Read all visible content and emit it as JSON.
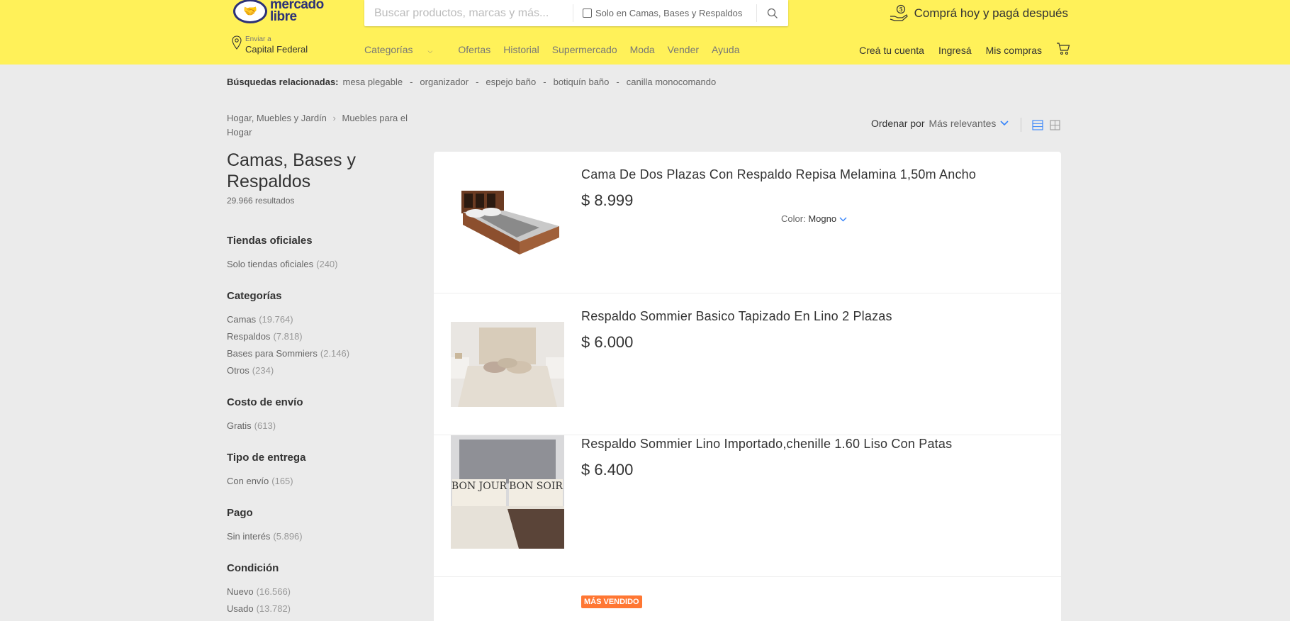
{
  "header": {
    "logo_top": "mercado",
    "logo_bottom": "libre",
    "search_placeholder": "Buscar productos, marcas y más...",
    "search_scope": "Solo en Camas, Bases y Respaldos",
    "promo": "Comprá hoy y pagá después",
    "location_label": "Enviar a",
    "location_value": "Capital Federal",
    "nav": [
      "Categorías",
      "Ofertas",
      "Historial",
      "Supermercado",
      "Moda",
      "Vender",
      "Ayuda"
    ],
    "account": [
      "Creá tu cuenta",
      "Ingresá",
      "Mis compras"
    ]
  },
  "related": {
    "label": "Búsquedas relacionadas:",
    "items": [
      "mesa plegable",
      "organizador",
      "espejo baño",
      "botiquín baño",
      "canilla monocomando"
    ]
  },
  "breadcrumb": {
    "level1": "Hogar, Muebles y Jardín",
    "level2": "Muebles para el Hogar"
  },
  "page": {
    "title": "Camas, Bases y Respaldos",
    "results": "29.966 resultados"
  },
  "filters": [
    {
      "title": "Tiendas oficiales",
      "items": [
        {
          "label": "Solo tiendas oficiales",
          "count": "(240)"
        }
      ]
    },
    {
      "title": "Categorías",
      "items": [
        {
          "label": "Camas",
          "count": "(19.764)"
        },
        {
          "label": "Respaldos",
          "count": "(7.818)"
        },
        {
          "label": "Bases para Sommiers",
          "count": "(2.146)"
        },
        {
          "label": "Otros",
          "count": "(234)"
        }
      ]
    },
    {
      "title": "Costo de envío",
      "items": [
        {
          "label": "Gratis",
          "count": "(613)"
        }
      ]
    },
    {
      "title": "Tipo de entrega",
      "items": [
        {
          "label": "Con envío",
          "count": "(165)"
        }
      ]
    },
    {
      "title": "Pago",
      "items": [
        {
          "label": "Sin interés",
          "count": "(5.896)"
        }
      ]
    },
    {
      "title": "Condición",
      "items": [
        {
          "label": "Nuevo",
          "count": "(16.566)"
        },
        {
          "label": "Usado",
          "count": "(13.782)"
        }
      ]
    }
  ],
  "sort": {
    "label": "Ordenar por",
    "value": "Más relevantes"
  },
  "products": [
    {
      "title": "Cama De Dos Plazas Con Respaldo Repisa Melamina 1,50m Ancho",
      "price": "$ 8.999",
      "color_label": "Color:",
      "color_value": "Mogno"
    },
    {
      "title": "Respaldo Sommier Basico Tapizado En Lino 2 Plazas",
      "price": "$ 6.000"
    },
    {
      "title": "Respaldo Sommier Lino Importado,chenille 1.60 Liso Con Patas",
      "price": "$ 6.400",
      "pillow_left": "BON JOUR",
      "pillow_right": "BON SOIR"
    }
  ],
  "badge": "MÁS VENDIDO",
  "colors": {
    "header_bg": "#fff159",
    "accent_blue": "#3483fa",
    "badge_orange": "#ff7733"
  }
}
